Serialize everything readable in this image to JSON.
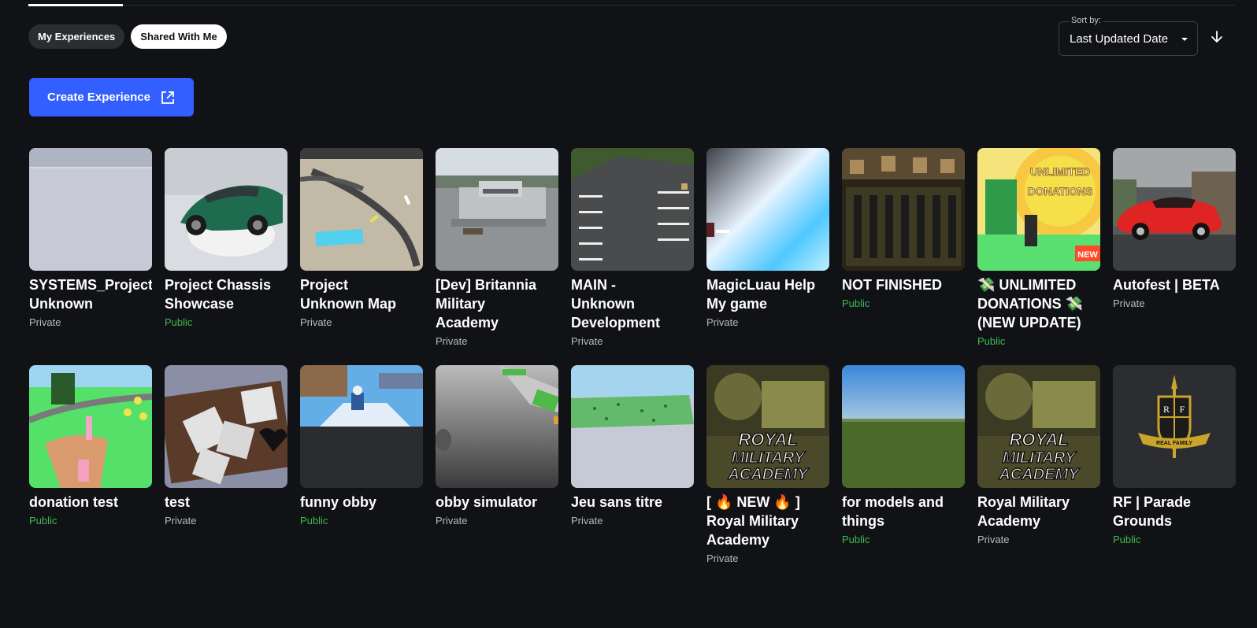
{
  "filters": {
    "my_experiences": "My Experiences",
    "shared_with_me": "Shared With Me"
  },
  "sort": {
    "label": "Sort by:",
    "value": "Last Updated Date",
    "direction_icon": "arrow-down-icon"
  },
  "create_button": {
    "label": "Create Experience",
    "icon": "external-link-icon"
  },
  "experiences_row1": [
    {
      "title": "SYSTEMS_Project Unknown",
      "line1": "SYSTEMS_Project",
      "line2": "Unknown",
      "status": "Private"
    },
    {
      "title": "Project Chassis Showcase",
      "line1": "Project Chassis",
      "line2": "Showcase",
      "status": "Public"
    },
    {
      "title": "Project Unknown Map",
      "line1": "Project",
      "line2": "Unknown Map",
      "status": "Private"
    },
    {
      "title": "[Dev] Britannia Military Academy",
      "line1": "[Dev] Britannia",
      "line2": "Military",
      "line3": "Academy",
      "status": "Private"
    },
    {
      "title": "MAIN - Unknown Development",
      "line1": "MAIN -",
      "line2": "Unknown",
      "line3": "Development",
      "status": "Private"
    },
    {
      "title": "MagicLuau Help My game",
      "line1": "MagicLuau Help",
      "line2": "My game",
      "status": "Private"
    },
    {
      "title": "NOT FINISHED",
      "line1": "NOT FINISHED",
      "status": "Public"
    },
    {
      "title": "💸 UNLIMITED DONATIONS 💸 (NEW UPDATE)",
      "line1": "💸 UNLIMITED",
      "line2": "DONATIONS 💸",
      "line3": "(NEW UPDATE)",
      "status": "Public"
    },
    {
      "title": "Autofest | BETA",
      "line1": "Autofest | BETA",
      "status": "Private"
    }
  ],
  "experiences_row2": [
    {
      "title": "donation test",
      "line1": "donation test",
      "status": "Public"
    },
    {
      "title": "test",
      "line1": "test",
      "status": "Private"
    },
    {
      "title": "funny obby",
      "line1": "funny obby",
      "status": "Public"
    },
    {
      "title": "obby simulator",
      "line1": "obby simulator",
      "status": "Private"
    },
    {
      "title": "Jeu sans titre",
      "line1": "Jeu sans titre",
      "status": "Private"
    },
    {
      "title": "[ 🔥 NEW 🔥 ] Royal Military Academy",
      "line1": "[ 🔥 NEW 🔥 ]",
      "line2": "Royal Military",
      "line3": "Academy",
      "status": "Private"
    },
    {
      "title": "for models and things",
      "line1": "for models and",
      "line2": "things",
      "status": "Public"
    },
    {
      "title": "Royal Military Academy",
      "line1": "Royal Military",
      "line2": "Academy",
      "status": "Private"
    },
    {
      "title": "RF | Parade Grounds",
      "line1": "RF | Parade",
      "line2": "Grounds",
      "status": "Public"
    }
  ],
  "thumbnail_text": {
    "unlimited_1": "UNLIMITED",
    "unlimited_2": "DONATIONS",
    "new_badge": "NEW",
    "rma_1": "ROYAL",
    "rma_2": "MILITARY",
    "rma_3": "ACADEMY",
    "rf_letter_1": "R",
    "rf_letter_2": "F",
    "rf_banner": "REAL FAMILY"
  },
  "colors": {
    "background": "#111216",
    "primary": "#335fff",
    "public": "#3fb950",
    "private": "#b9babd"
  }
}
